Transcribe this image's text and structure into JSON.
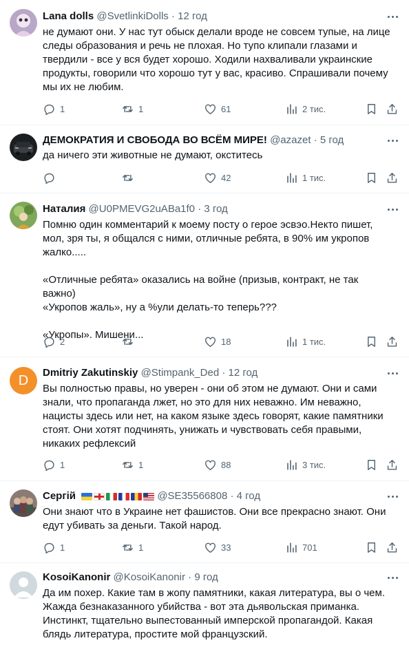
{
  "tweets": [
    {
      "name": "Lana dolls",
      "handle": "@SvetlinkiDolls",
      "time": "12 год",
      "text": "не думают они. У нас тут обыск делали вроде не совсем тупые, на лице\nследы образования и речь не плохая. Но тупо клипали глазами и\nтвердили - все у вся будет хорошо. Ходили нахваливали украинские\nпродукты, говорили что хорошо тут у вас, красиво. Спрашивали почему\nмы их не любим.",
      "replies": "1",
      "retweets": "1",
      "likes": "61",
      "views": "2 тис."
    },
    {
      "name": "ДЕМОКРАТИЯ И СВОБОДА ВО ВСЁМ МИРЕ!",
      "handle": "@azazet",
      "time": "5 год",
      "text": "да ничего эти животные не думают, окститесь",
      "replies": "",
      "retweets": "",
      "likes": "42",
      "views": "1 тис."
    },
    {
      "name": "Наталия",
      "handle": "@U0PMEVG2uABa1f0",
      "time": "3 год",
      "text": "Помню один комментарий к моему посту о герое эсвэо.Некто пишет,\nмол, зря ты, я общался с ними, отличные ребята, в 90% им укропов\nжалко.....\n\n«Отличные ребята» оказались на войне (призыв, контракт, не так важно)\n«Укропов жаль», ну а %ули делать-то теперь???\n\n«Укропы». Мишени...",
      "replies": "2",
      "retweets": "",
      "likes": "18",
      "views": "1 тис."
    },
    {
      "name": "Dmitriy Zakutinskiy",
      "handle": "@Stimpank_Ded",
      "time": "12 год",
      "avatar_letter": "D",
      "text": "Вы полностью правы, но уверен - они об этом не думают. Они и сами\nзнали, что пропаганда лжет, но это для них неважно. Им неважно,\nнацисты здесь или нет, на каком языке здесь говорят, какие памятники\nстоят. Они хотят подчинять, унижать и чувствовать себя правыми,\nникаких рефлексий",
      "replies": "1",
      "retweets": "1",
      "likes": "88",
      "views": "3 тис."
    },
    {
      "name": "Сергій",
      "handle": "@SE35566808",
      "time": "4 год",
      "text": "Они знают что в Украине нет фашистов. Они все прекрасно знают. Они\nедут убивать за деньги. Такой народ.",
      "replies": "1",
      "retweets": "1",
      "likes": "33",
      "views": "701"
    },
    {
      "name": "KosoiKanonir",
      "handle": "@KosoiKanonir",
      "time": "9 год",
      "text": "Да им похер. Какие там в жопу памятники, какая литература, вы о чем.\nЖажда безнаказанного убийства - вот эта дьявольская приманка.\nИнстинкт, тщательно выпестованный имперской пропагандой. Какая\nблядь литература, простите мой французский."
    }
  ],
  "colors": {
    "text": "#0f1419",
    "muted": "#536471",
    "divider": "#eff3f4",
    "avatar_d": "#f4902a"
  }
}
